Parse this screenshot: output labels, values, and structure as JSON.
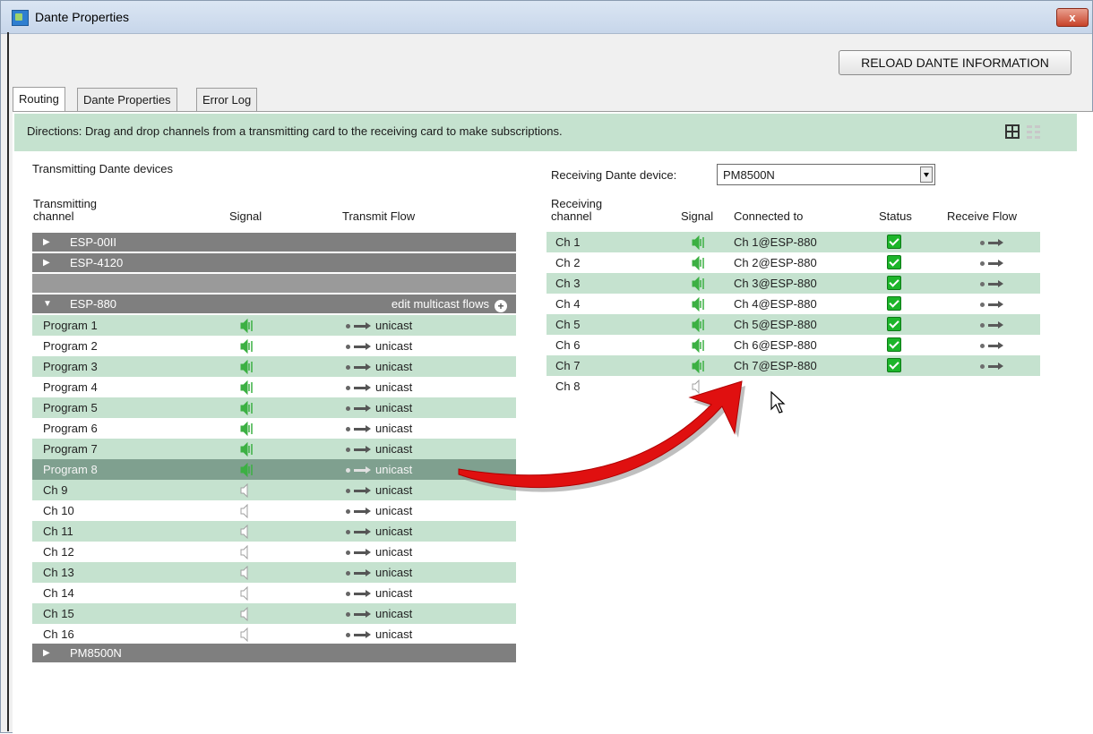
{
  "window": {
    "title": "Dante Properties",
    "close_glyph": "x"
  },
  "toolbar": {
    "reload_label": "RELOAD DANTE INFORMATION"
  },
  "tabs": [
    {
      "label": "Routing",
      "active": true
    },
    {
      "label": "Dante Properties",
      "active": false
    },
    {
      "label": "Error Log",
      "active": false
    }
  ],
  "directions": "Directions: Drag and drop channels from a transmitting card to the receiving card to make subscriptions.",
  "view_icons": [
    "grid-view-icon",
    "list-view-icon"
  ],
  "transmit": {
    "section_title": "Transmitting Dante devices",
    "headers": {
      "channel_line1": "Transmitting",
      "channel_line2": "channel",
      "signal": "Signal",
      "flow": "Transmit Flow"
    },
    "devices": [
      {
        "name": "ESP-00II",
        "expanded": false
      },
      {
        "name": "ESP-4120",
        "expanded": false
      },
      {
        "name": "",
        "expanded": false
      },
      {
        "name": "ESP-880",
        "expanded": true,
        "edit_label": "edit multicast flows"
      },
      {
        "name": "PM8500N",
        "expanded": false
      }
    ],
    "channels": [
      {
        "name": "Program 1",
        "signal": true,
        "flow": "unicast"
      },
      {
        "name": "Program 2",
        "signal": true,
        "flow": "unicast"
      },
      {
        "name": "Program 3",
        "signal": true,
        "flow": "unicast"
      },
      {
        "name": "Program 4",
        "signal": true,
        "flow": "unicast"
      },
      {
        "name": "Program 5",
        "signal": true,
        "flow": "unicast"
      },
      {
        "name": "Program 6",
        "signal": true,
        "flow": "unicast"
      },
      {
        "name": "Program 7",
        "signal": true,
        "flow": "unicast"
      },
      {
        "name": "Program 8",
        "signal": true,
        "flow": "unicast",
        "selected": true
      },
      {
        "name": "Ch 9",
        "signal": false,
        "flow": "unicast"
      },
      {
        "name": "Ch 10",
        "signal": false,
        "flow": "unicast"
      },
      {
        "name": "Ch 11",
        "signal": false,
        "flow": "unicast"
      },
      {
        "name": "Ch 12",
        "signal": false,
        "flow": "unicast"
      },
      {
        "name": "Ch 13",
        "signal": false,
        "flow": "unicast"
      },
      {
        "name": "Ch 14",
        "signal": false,
        "flow": "unicast"
      },
      {
        "name": "Ch 15",
        "signal": false,
        "flow": "unicast"
      },
      {
        "name": "Ch 16",
        "signal": false,
        "flow": "unicast"
      }
    ]
  },
  "receive": {
    "device_label": "Receiving Dante device:",
    "device_value": "PM8500N",
    "headers": {
      "channel_line1": "Receiving",
      "channel_line2": "channel",
      "signal": "Signal",
      "connected": "Connected to",
      "status": "Status",
      "flow": "Receive Flow"
    },
    "channels": [
      {
        "name": "Ch 1",
        "signal": true,
        "connected": "Ch 1@ESP-880",
        "status": true
      },
      {
        "name": "Ch 2",
        "signal": true,
        "connected": "Ch 2@ESP-880",
        "status": true
      },
      {
        "name": "Ch 3",
        "signal": true,
        "connected": "Ch 3@ESP-880",
        "status": true
      },
      {
        "name": "Ch 4",
        "signal": true,
        "connected": "Ch 4@ESP-880",
        "status": true
      },
      {
        "name": "Ch 5",
        "signal": true,
        "connected": "Ch 5@ESP-880",
        "status": true
      },
      {
        "name": "Ch 6",
        "signal": true,
        "connected": "Ch 6@ESP-880",
        "status": true
      },
      {
        "name": "Ch 7",
        "signal": true,
        "connected": "Ch 7@ESP-880",
        "status": true
      },
      {
        "name": "Ch 8",
        "signal": false,
        "connected": "",
        "status": false
      }
    ]
  },
  "colors": {
    "row_green": "#c5e2cf",
    "device_header": "#7f7f7f",
    "selected_row": "#7fa08f",
    "speaker_active": "#3cb043",
    "speaker_idle": "#a0a0a0",
    "status_ok": "#1cb52a",
    "drag_arrow": "#e01010"
  }
}
